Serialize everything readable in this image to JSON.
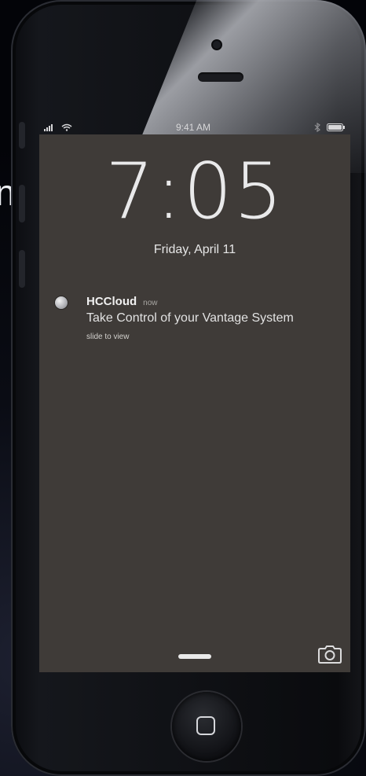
{
  "background": {
    "side_letter": "n"
  },
  "statusbar": {
    "time": "9:41 AM",
    "icons": [
      "signal-bars-icon",
      "wifi-icon",
      "bluetooth-icon",
      "battery-icon"
    ]
  },
  "lockscreen": {
    "clock": "7:05",
    "date": "Friday, April 11",
    "notification": {
      "app": "HCCloud",
      "time": "now",
      "message": "Take Control of your Vantage System",
      "hint": "slide to view",
      "icon": "app-icon"
    },
    "bottom": {
      "grabber_icon": "grabber-icon",
      "camera_icon": "camera-icon"
    }
  },
  "device": {
    "home_button_icon": "home-button-icon"
  },
  "colors": {
    "screen_bg": "#3f3b38",
    "text_primary": "#e9e9ea"
  }
}
